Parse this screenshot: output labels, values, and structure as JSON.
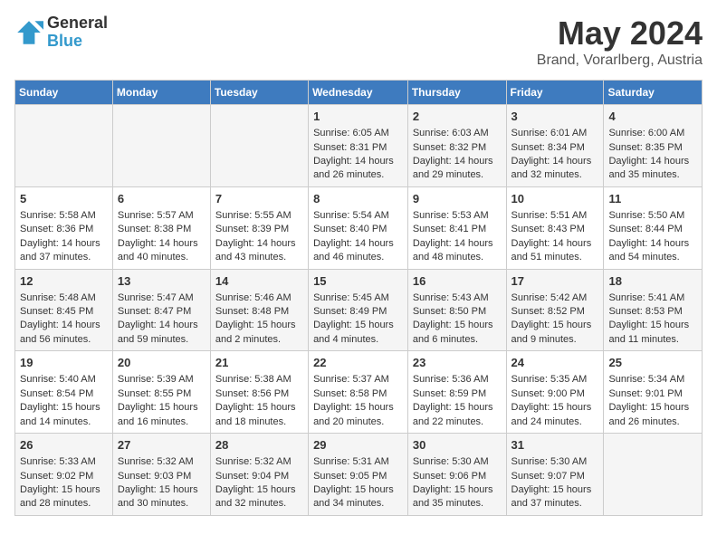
{
  "header": {
    "logo_line1": "General",
    "logo_line2": "Blue",
    "title": "May 2024",
    "subtitle": "Brand, Vorarlberg, Austria"
  },
  "calendar": {
    "days_of_week": [
      "Sunday",
      "Monday",
      "Tuesday",
      "Wednesday",
      "Thursday",
      "Friday",
      "Saturday"
    ],
    "weeks": [
      [
        {
          "day": "",
          "content": ""
        },
        {
          "day": "",
          "content": ""
        },
        {
          "day": "",
          "content": ""
        },
        {
          "day": "1",
          "content": "Sunrise: 6:05 AM\nSunset: 8:31 PM\nDaylight: 14 hours and 26 minutes."
        },
        {
          "day": "2",
          "content": "Sunrise: 6:03 AM\nSunset: 8:32 PM\nDaylight: 14 hours and 29 minutes."
        },
        {
          "day": "3",
          "content": "Sunrise: 6:01 AM\nSunset: 8:34 PM\nDaylight: 14 hours and 32 minutes."
        },
        {
          "day": "4",
          "content": "Sunrise: 6:00 AM\nSunset: 8:35 PM\nDaylight: 14 hours and 35 minutes."
        }
      ],
      [
        {
          "day": "5",
          "content": "Sunrise: 5:58 AM\nSunset: 8:36 PM\nDaylight: 14 hours and 37 minutes."
        },
        {
          "day": "6",
          "content": "Sunrise: 5:57 AM\nSunset: 8:38 PM\nDaylight: 14 hours and 40 minutes."
        },
        {
          "day": "7",
          "content": "Sunrise: 5:55 AM\nSunset: 8:39 PM\nDaylight: 14 hours and 43 minutes."
        },
        {
          "day": "8",
          "content": "Sunrise: 5:54 AM\nSunset: 8:40 PM\nDaylight: 14 hours and 46 minutes."
        },
        {
          "day": "9",
          "content": "Sunrise: 5:53 AM\nSunset: 8:41 PM\nDaylight: 14 hours and 48 minutes."
        },
        {
          "day": "10",
          "content": "Sunrise: 5:51 AM\nSunset: 8:43 PM\nDaylight: 14 hours and 51 minutes."
        },
        {
          "day": "11",
          "content": "Sunrise: 5:50 AM\nSunset: 8:44 PM\nDaylight: 14 hours and 54 minutes."
        }
      ],
      [
        {
          "day": "12",
          "content": "Sunrise: 5:48 AM\nSunset: 8:45 PM\nDaylight: 14 hours and 56 minutes."
        },
        {
          "day": "13",
          "content": "Sunrise: 5:47 AM\nSunset: 8:47 PM\nDaylight: 14 hours and 59 minutes."
        },
        {
          "day": "14",
          "content": "Sunrise: 5:46 AM\nSunset: 8:48 PM\nDaylight: 15 hours and 2 minutes."
        },
        {
          "day": "15",
          "content": "Sunrise: 5:45 AM\nSunset: 8:49 PM\nDaylight: 15 hours and 4 minutes."
        },
        {
          "day": "16",
          "content": "Sunrise: 5:43 AM\nSunset: 8:50 PM\nDaylight: 15 hours and 6 minutes."
        },
        {
          "day": "17",
          "content": "Sunrise: 5:42 AM\nSunset: 8:52 PM\nDaylight: 15 hours and 9 minutes."
        },
        {
          "day": "18",
          "content": "Sunrise: 5:41 AM\nSunset: 8:53 PM\nDaylight: 15 hours and 11 minutes."
        }
      ],
      [
        {
          "day": "19",
          "content": "Sunrise: 5:40 AM\nSunset: 8:54 PM\nDaylight: 15 hours and 14 minutes."
        },
        {
          "day": "20",
          "content": "Sunrise: 5:39 AM\nSunset: 8:55 PM\nDaylight: 15 hours and 16 minutes."
        },
        {
          "day": "21",
          "content": "Sunrise: 5:38 AM\nSunset: 8:56 PM\nDaylight: 15 hours and 18 minutes."
        },
        {
          "day": "22",
          "content": "Sunrise: 5:37 AM\nSunset: 8:58 PM\nDaylight: 15 hours and 20 minutes."
        },
        {
          "day": "23",
          "content": "Sunrise: 5:36 AM\nSunset: 8:59 PM\nDaylight: 15 hours and 22 minutes."
        },
        {
          "day": "24",
          "content": "Sunrise: 5:35 AM\nSunset: 9:00 PM\nDaylight: 15 hours and 24 minutes."
        },
        {
          "day": "25",
          "content": "Sunrise: 5:34 AM\nSunset: 9:01 PM\nDaylight: 15 hours and 26 minutes."
        }
      ],
      [
        {
          "day": "26",
          "content": "Sunrise: 5:33 AM\nSunset: 9:02 PM\nDaylight: 15 hours and 28 minutes."
        },
        {
          "day": "27",
          "content": "Sunrise: 5:32 AM\nSunset: 9:03 PM\nDaylight: 15 hours and 30 minutes."
        },
        {
          "day": "28",
          "content": "Sunrise: 5:32 AM\nSunset: 9:04 PM\nDaylight: 15 hours and 32 minutes."
        },
        {
          "day": "29",
          "content": "Sunrise: 5:31 AM\nSunset: 9:05 PM\nDaylight: 15 hours and 34 minutes."
        },
        {
          "day": "30",
          "content": "Sunrise: 5:30 AM\nSunset: 9:06 PM\nDaylight: 15 hours and 35 minutes."
        },
        {
          "day": "31",
          "content": "Sunrise: 5:30 AM\nSunset: 9:07 PM\nDaylight: 15 hours and 37 minutes."
        },
        {
          "day": "",
          "content": ""
        }
      ]
    ]
  }
}
